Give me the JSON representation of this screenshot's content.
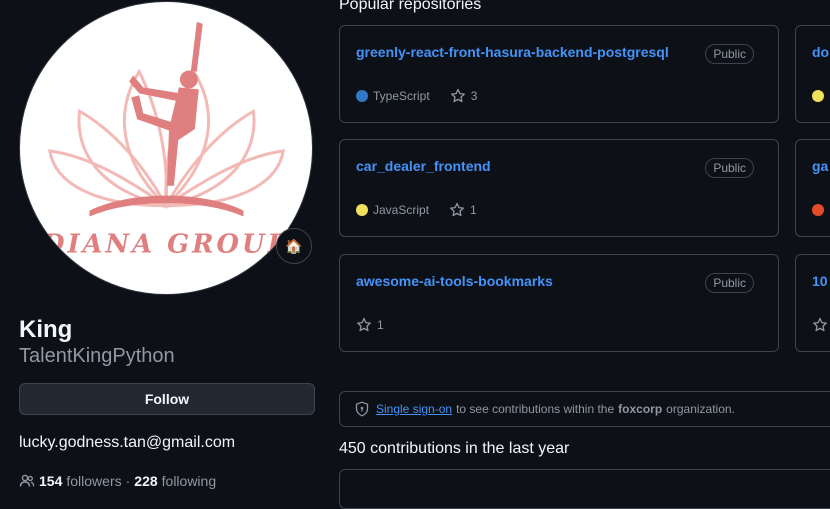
{
  "profile": {
    "name": "King",
    "login": "TalentKingPython",
    "follow_label": "Follow",
    "email": "lucky.godness.tan@gmail.com",
    "followers_count": "154",
    "followers_label": "followers",
    "separator": "·",
    "following_count": "228",
    "following_label": "following",
    "status_emoji": "🏠",
    "avatar_logo_text": "DIANA GROUP"
  },
  "popular": {
    "title": "Popular repositories",
    "repos": [
      {
        "name": "greenly-react-front-hasura-backend-postgresql",
        "visibility": "Public",
        "language": "TypeScript",
        "language_color": "#3178c6",
        "stars": "3"
      },
      {
        "name": "car_dealer_frontend",
        "visibility": "Public",
        "language": "JavaScript",
        "language_color": "#f1e05a",
        "stars": "1"
      },
      {
        "name": "awesome-ai-tools-bookmarks",
        "visibility": "Public",
        "language": "",
        "language_color": "",
        "stars": "1"
      }
    ],
    "partial_repos": [
      {
        "name_fragment": "do",
        "language_color": "#f1e05a"
      },
      {
        "name_fragment": "ga",
        "language_color": "#e34c26"
      },
      {
        "name_fragment": "10",
        "language_color": ""
      }
    ]
  },
  "sso": {
    "link": "Single sign-on",
    "text_before_org": "to see contributions within the",
    "org": "foxcorp",
    "text_after_org": "organization."
  },
  "contributions": {
    "title": "450 contributions in the last year"
  },
  "colors": {
    "background": "#0d1117",
    "border": "#3d444d",
    "link": "#4493f8",
    "muted": "#9198a1",
    "avatar_logo": "#e07f7f"
  }
}
